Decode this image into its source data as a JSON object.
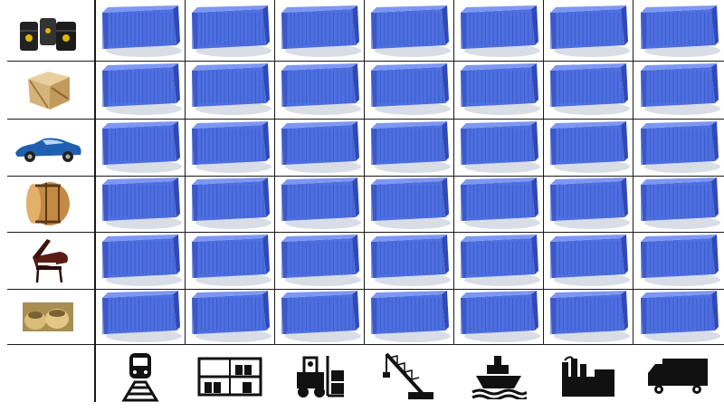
{
  "colors": {
    "container_body": "#4d6fe0",
    "container_dark": "#2f49b8",
    "container_light": "#7d97f2",
    "shadow": "#d9dde6",
    "grid_line": "#1a1a1a",
    "icon": "#111111"
  },
  "cargo_rows": [
    {
      "icon": "oil-barrels-icon"
    },
    {
      "icon": "wooden-crate-icon"
    },
    {
      "icon": "sports-car-icon"
    },
    {
      "icon": "wine-barrel-icon"
    },
    {
      "icon": "grand-piano-icon"
    },
    {
      "icon": "sacks-icon"
    }
  ],
  "transport_columns": [
    {
      "icon": "train-icon"
    },
    {
      "icon": "warehouse-rack-icon"
    },
    {
      "icon": "forklift-icon"
    },
    {
      "icon": "crane-icon"
    },
    {
      "icon": "ship-icon"
    },
    {
      "icon": "factory-icon"
    },
    {
      "icon": "truck-icon"
    }
  ]
}
